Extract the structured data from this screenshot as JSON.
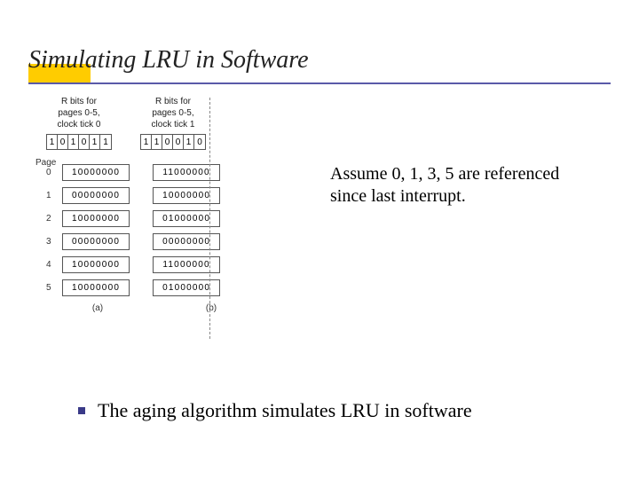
{
  "title": "Simulating LRU in Software",
  "headers": {
    "a": "R bits for\npages 0-5,\nclock tick 0",
    "b": "R bits for\npages 0-5,\nclock tick 1"
  },
  "rbits": {
    "a": [
      "1",
      "0",
      "1",
      "0",
      "1",
      "1"
    ],
    "b": [
      "1",
      "1",
      "0",
      "0",
      "1",
      "0"
    ]
  },
  "page_label": "Page",
  "rows": [
    {
      "n": "0",
      "a": "10000000",
      "b": "11000000"
    },
    {
      "n": "1",
      "a": "00000000",
      "b": "10000000"
    },
    {
      "n": "2",
      "a": "10000000",
      "b": "01000000"
    },
    {
      "n": "3",
      "a": "00000000",
      "b": "00000000"
    },
    {
      "n": "4",
      "a": "10000000",
      "b": "11000000"
    },
    {
      "n": "5",
      "a": "10000000",
      "b": "01000000"
    }
  ],
  "subs": {
    "a": "(a)",
    "b": "(b)"
  },
  "annotation": "Assume 0, 1, 3, 5 are referenced since last interrupt.",
  "bullet": "The aging algorithm simulates LRU in software"
}
